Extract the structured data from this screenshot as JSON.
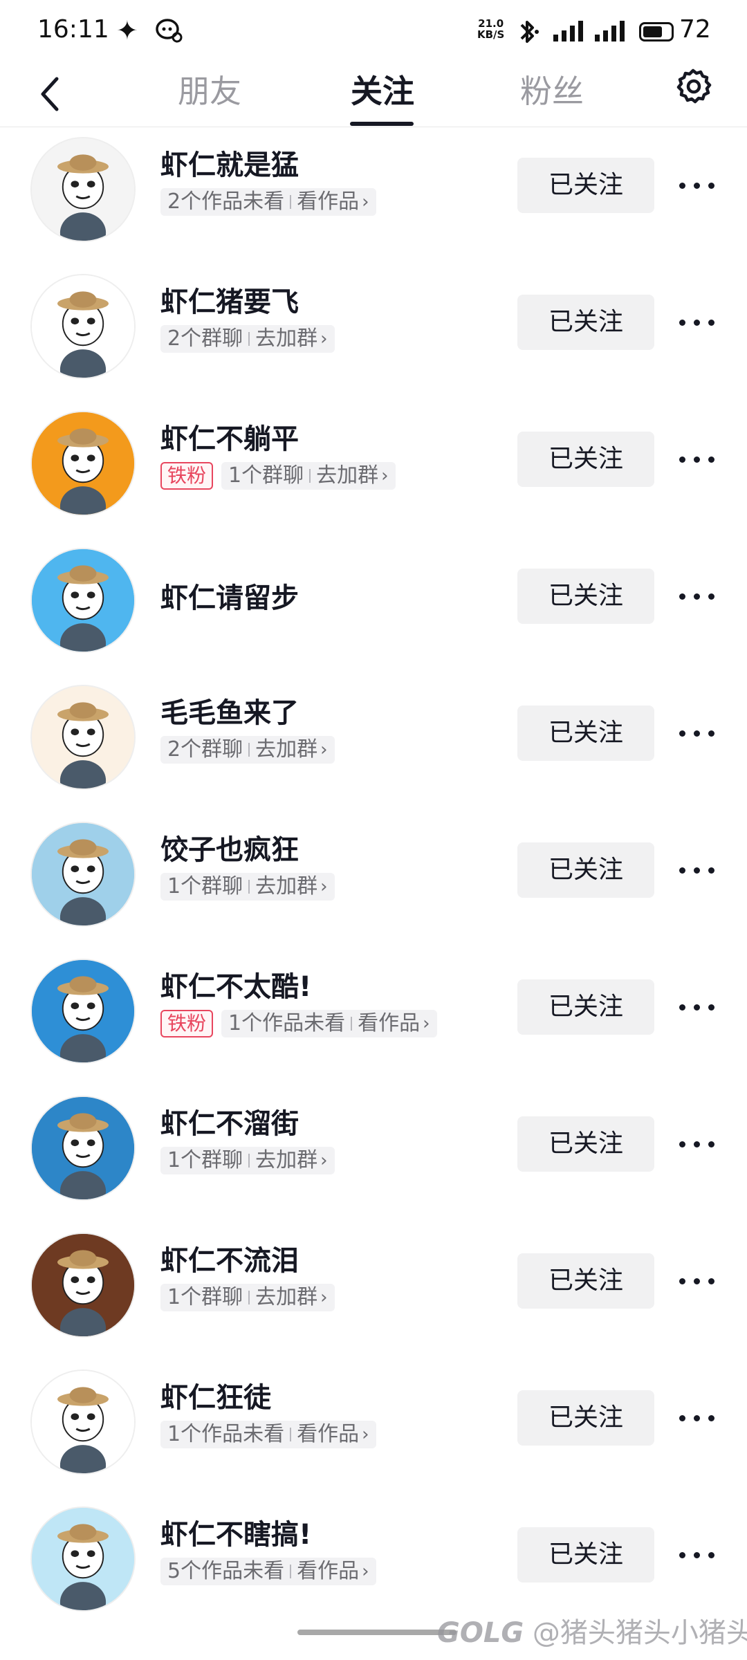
{
  "status_bar": {
    "time": "16:11",
    "net_speed_value": "21.0",
    "net_speed_unit": "KB/S",
    "battery": "72",
    "battery_level": 0.72
  },
  "nav": {
    "tabs": [
      {
        "label": "朋友",
        "active": false
      },
      {
        "label": "关注",
        "active": true
      },
      {
        "label": "粉丝",
        "active": false
      }
    ]
  },
  "list": {
    "follow_label": "已关注",
    "items": [
      {
        "name": "虾仁就是猛",
        "badge": "",
        "chip_left": "2个作品未看",
        "chip_right": "看作品",
        "avatar_bg": "#f4f4f4"
      },
      {
        "name": "虾仁猪要飞",
        "badge": "",
        "chip_left": "2个群聊",
        "chip_right": "去加群",
        "avatar_bg": "#ffffff"
      },
      {
        "name": "虾仁不躺平",
        "badge": "铁粉",
        "chip_left": "1个群聊",
        "chip_right": "去加群",
        "avatar_bg": "#f39a1c"
      },
      {
        "name": "虾仁请留步",
        "badge": "",
        "chip_left": "",
        "chip_right": "",
        "avatar_bg": "#4fb6ef"
      },
      {
        "name": "毛毛鱼来了",
        "badge": "",
        "chip_left": "2个群聊",
        "chip_right": "去加群",
        "avatar_bg": "#fbf1e4"
      },
      {
        "name": "饺子也疯狂",
        "badge": "",
        "chip_left": "1个群聊",
        "chip_right": "去加群",
        "avatar_bg": "#9fd0ea"
      },
      {
        "name": "虾仁不太酷!",
        "badge": "铁粉",
        "chip_left": "1个作品未看",
        "chip_right": "看作品",
        "avatar_bg": "#2e8fd6"
      },
      {
        "name": "虾仁不溜街",
        "badge": "",
        "chip_left": "1个群聊",
        "chip_right": "去加群",
        "avatar_bg": "#2d86c8"
      },
      {
        "name": "虾仁不流泪",
        "badge": "",
        "chip_left": "1个群聊",
        "chip_right": "去加群",
        "avatar_bg": "#6e3a22"
      },
      {
        "name": "虾仁狂徒",
        "badge": "",
        "chip_left": "1个作品未看",
        "chip_right": "看作品",
        "avatar_bg": "#ffffff"
      },
      {
        "name": "虾仁不瞎搞!",
        "badge": "",
        "chip_left": "5个作品未看",
        "chip_right": "看作品",
        "avatar_bg": "#bfe6f6"
      }
    ]
  },
  "watermark": {
    "logo": "GOLG",
    "text": "@猪头猪头小猪头"
  }
}
